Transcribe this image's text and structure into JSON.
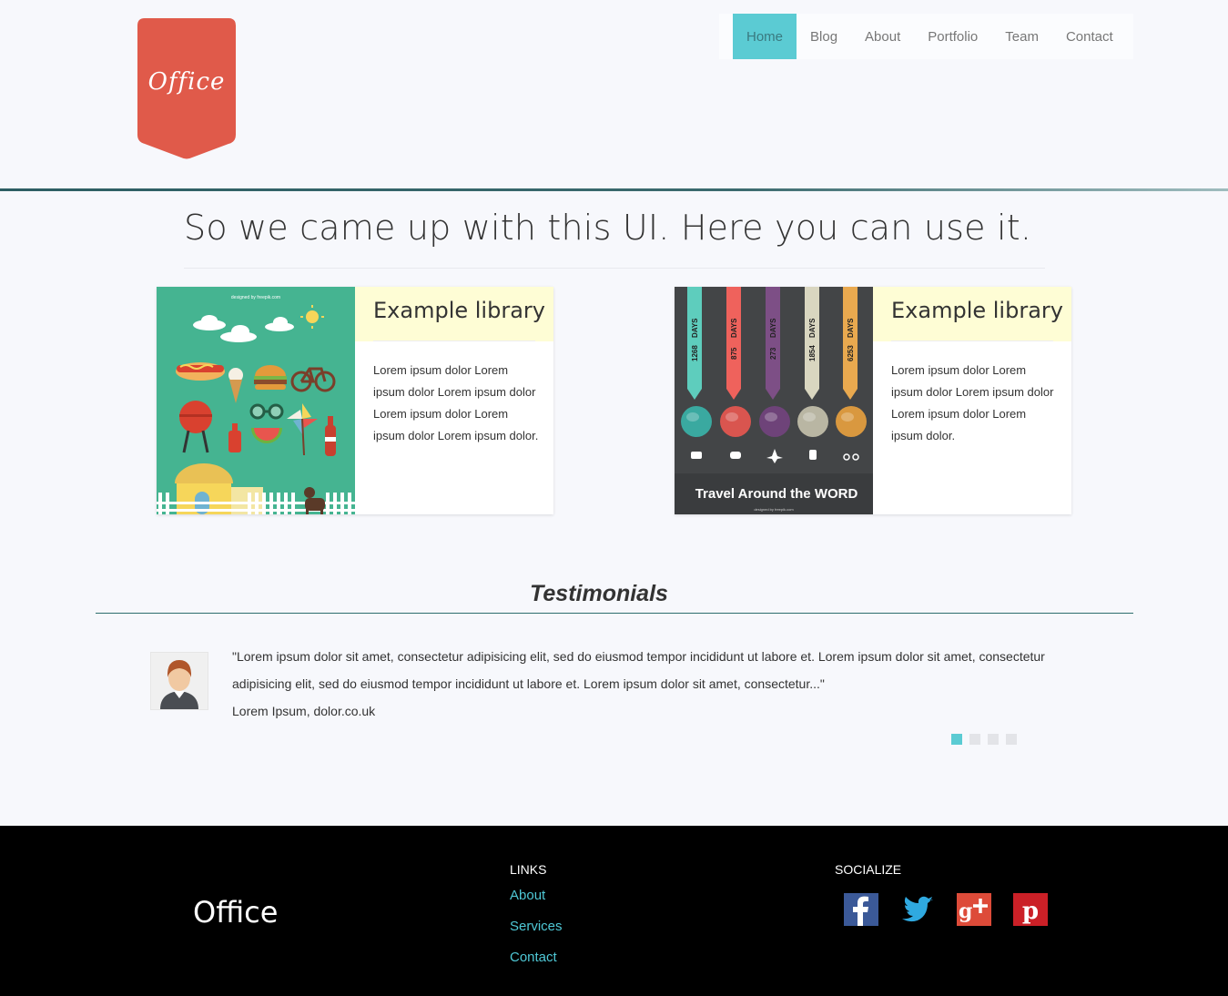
{
  "brand": {
    "name": "Office",
    "badge_color": "#e05a4a"
  },
  "nav": {
    "items": [
      {
        "label": "Home",
        "active": true
      },
      {
        "label": "Blog",
        "active": false
      },
      {
        "label": "About",
        "active": false
      },
      {
        "label": "Portfolio",
        "active": false
      },
      {
        "label": "Team",
        "active": false
      },
      {
        "label": "Contact",
        "active": false
      }
    ],
    "active_color": "#5bcbd3"
  },
  "hero": {
    "title": "So we came up with this UI. Here you can use it."
  },
  "cards": [
    {
      "title": "Example library",
      "body": "Lorem ipsum dolor Lorem ipsum dolor Lorem ipsum dolor Lorem ipsum dolor Lorem ipsum dolor Lorem ipsum dolor.",
      "image": {
        "credit": "designed by freepik.com",
        "icons": [
          "hotdog-icon",
          "ice-cream-icon",
          "burger-icon",
          "bicycle-icon",
          "grill-icon",
          "ketchup-icon",
          "glasses-icon",
          "watermelon-icon",
          "pinwheel-icon",
          "soda-bottle-icon",
          "house-icon",
          "dog-icon"
        ]
      }
    },
    {
      "title": "Example library",
      "body": "Lorem ipsum dolor Lorem ipsum dolor Lorem ipsum dolor Lorem ipsum dolor Lorem ipsum dolor.",
      "image": {
        "ribbons": [
          {
            "number": "1268",
            "unit": "DAYS",
            "color": "#5ecdbd"
          },
          {
            "number": "875",
            "unit": "DAYS",
            "color": "#ef625c"
          },
          {
            "number": "273",
            "unit": "DAYS",
            "color": "#7d4f86"
          },
          {
            "number": "1854",
            "unit": "DAYS",
            "color": "#d9d6c0"
          },
          {
            "number": "6253",
            "unit": "DAYS",
            "color": "#e9a94f"
          }
        ],
        "caption": "Travel Around the WORD",
        "credit": "designed by freepik.com"
      }
    }
  ],
  "testimonials": {
    "title": "Testimonials",
    "quote": "\"Lorem ipsum dolor sit amet, consectetur adipisicing elit, sed do eiusmod tempor incididunt ut labore et. Lorem ipsum dolor sit amet, consectetur adipisicing elit, sed do eiusmod tempor incididunt ut labore et. Lorem ipsum dolor sit amet, consectetur...\"",
    "source": "Lorem Ipsum, dolor.co.uk",
    "pager_count": 4,
    "pager_active": 1
  },
  "footer": {
    "logo": "Office",
    "links_heading": "LINKS",
    "links": [
      "About",
      "Services",
      "Contact"
    ],
    "social_heading": "SOCIALIZE",
    "social": [
      {
        "icon": "facebook-icon",
        "color": "#3b5998"
      },
      {
        "icon": "twitter-icon",
        "color": "#2fa9e0"
      },
      {
        "icon": "google-plus-icon",
        "color": "#dd4b39"
      },
      {
        "icon": "pinterest-icon",
        "color": "#cb2027"
      }
    ]
  }
}
